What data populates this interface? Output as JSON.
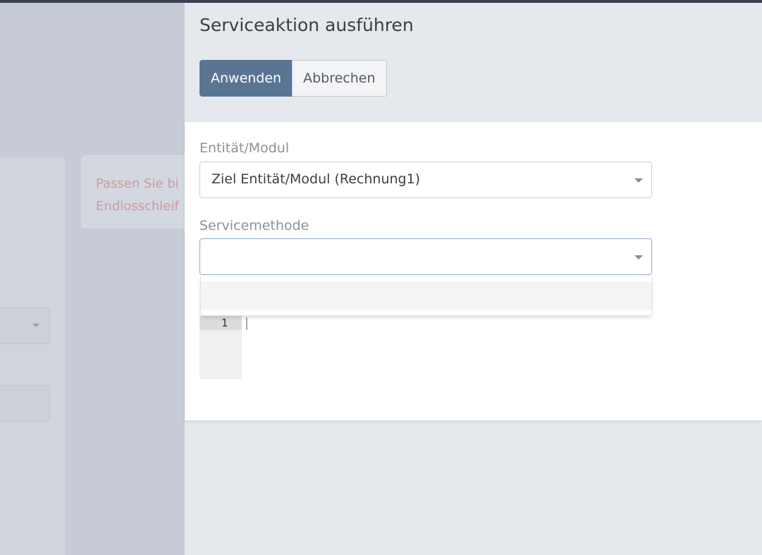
{
  "background": {
    "note_text_line1": "Passen Sie bi",
    "note_text_line2": "Endlosschleif"
  },
  "modal": {
    "title": "Serviceaktion ausführen",
    "buttons": {
      "apply_label": "Anwenden",
      "cancel_label": "Abbrechen"
    },
    "fields": {
      "entity": {
        "label": "Entität/Modul",
        "value": "Ziel Entität/Modul (Rechnung1)"
      },
      "service_method": {
        "label": "Servicemethode",
        "value": ""
      }
    },
    "editor": {
      "line_number": "1"
    }
  },
  "colors": {
    "primary": "#5a7494",
    "panel_header": "#e5e8ec",
    "overlay": "#c9ced8"
  }
}
